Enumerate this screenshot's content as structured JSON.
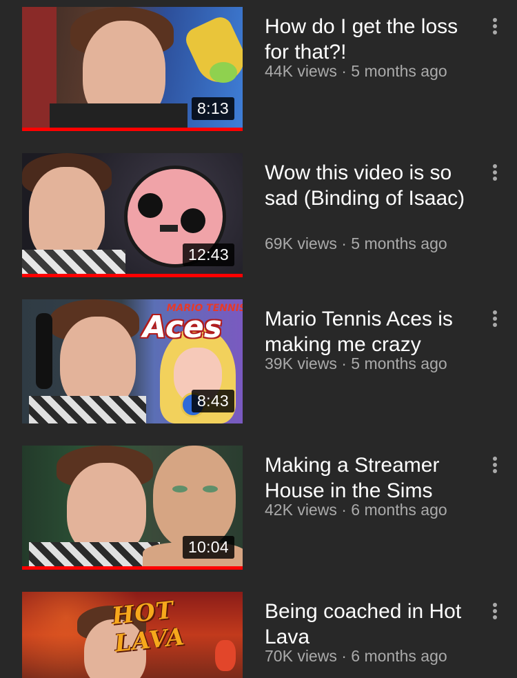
{
  "videos": [
    {
      "title": "How do I get the loss for that?!",
      "views": "44K views",
      "age": "5 months ago",
      "duration": "8:13",
      "progress": 1.0
    },
    {
      "title": "Wow this video is so sad (Binding of Isaac)",
      "views": "69K views",
      "age": "5 months ago",
      "duration": "12:43",
      "progress": 1.0
    },
    {
      "title": "Mario Tennis Aces is making me crazy",
      "views": "39K views",
      "age": "5 months ago",
      "duration": "8:43",
      "progress": 0
    },
    {
      "title": "Making a Streamer House in the Sims",
      "views": "42K views",
      "age": "6 months ago",
      "duration": "10:04",
      "progress": 1.0
    },
    {
      "title": "Being coached in Hot Lava",
      "views": "70K views",
      "age": "6 months ago",
      "duration": "",
      "progress": 0
    }
  ],
  "thumb_text": {
    "mario_tennis_logo_top": "MARIO TENNIS",
    "mario_tennis_logo_main": "Aces",
    "hot_lava_logo": "HOT LAVA"
  },
  "separator": " · ",
  "icons": {
    "more": "more-vert-icon"
  },
  "colors": {
    "background": "#282828",
    "progress": "#ff0000",
    "meta": "#aaaaaa",
    "title": "#ffffff"
  }
}
